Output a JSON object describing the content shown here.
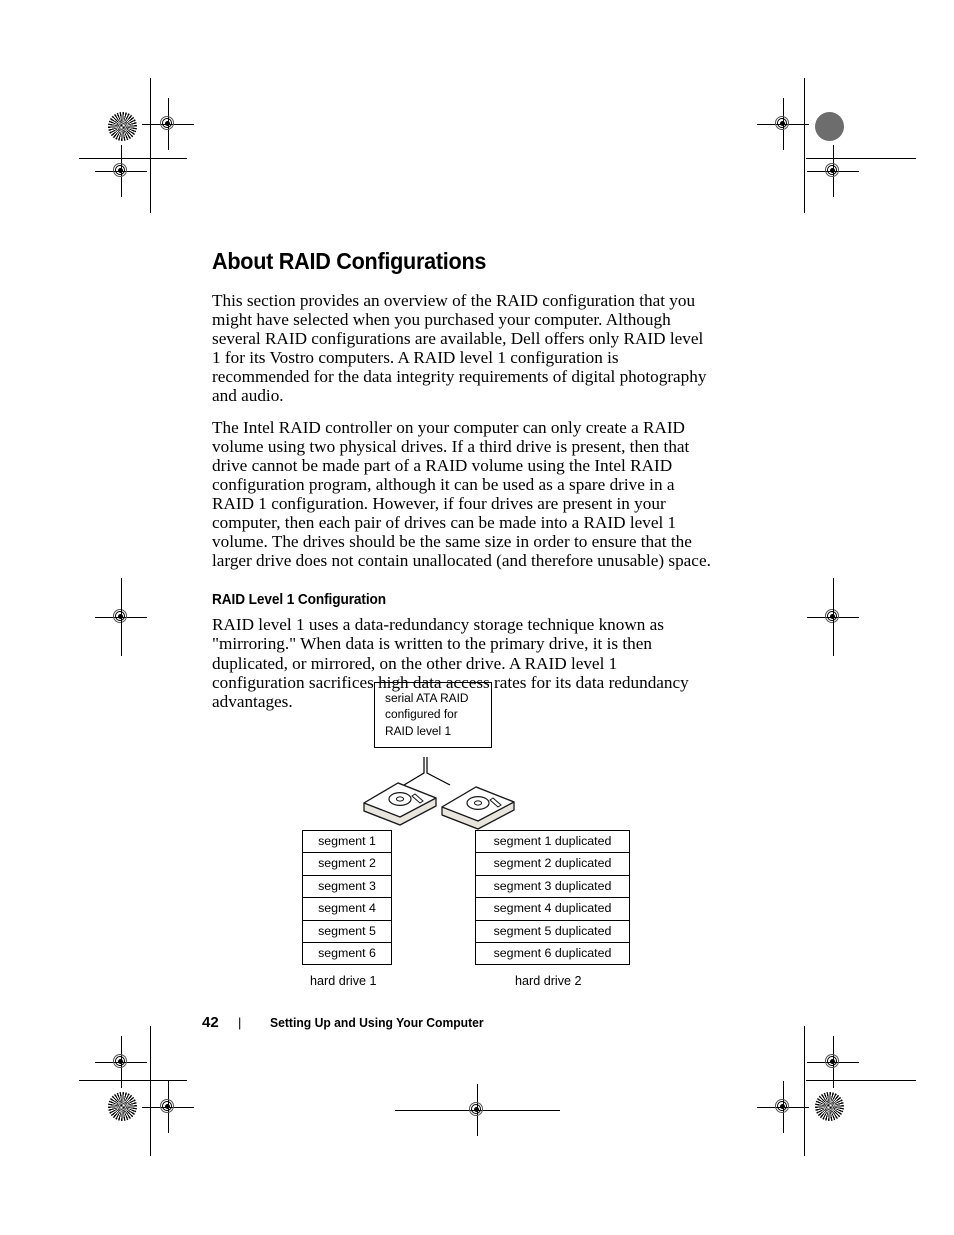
{
  "document": {
    "heading": "About RAID Configurations",
    "paragraphs": [
      "This section provides an overview of the RAID configuration that you might have selected when you purchased your computer. Although several RAID configurations are available, Dell offers only RAID level 1 for its Vostro computers. A RAID level 1 configuration is recommended for the data integrity requirements of digital photography and audio.",
      "The Intel RAID controller on your computer can only create a RAID volume using two physical drives. If a third drive is present, then that drive cannot be made part of a RAID volume using the Intel RAID configuration program, although it can be used as a spare drive in a RAID 1 configuration. However, if four drives are present in your computer, then each pair of drives can be made into a RAID level 1 volume. The drives should be the same size in order to ensure that the larger drive does not contain unallocated (and therefore unusable) space."
    ],
    "subheading": "RAID Level 1 Configuration",
    "subsection_paragraph": "RAID level 1 uses a data-redundancy storage technique known as \"mirroring.\" When data is written to the primary drive, it is then duplicated, or mirrored, on the other drive. A RAID level 1 configuration sacrifices high data access rates for its data redundancy advantages."
  },
  "figure": {
    "callout": {
      "line1": "serial ATA RAID",
      "line2": "configured for",
      "line3": "RAID level 1"
    },
    "drive1": {
      "caption": "hard drive 1",
      "segments": [
        "segment 1",
        "segment 2",
        "segment 3",
        "segment 4",
        "segment 5",
        "segment 6"
      ]
    },
    "drive2": {
      "caption": "hard drive 2",
      "segments": [
        "segment 1 duplicated",
        "segment 2 duplicated",
        "segment 3 duplicated",
        "segment 4 duplicated",
        "segment 5 duplicated",
        "segment 6 duplicated"
      ]
    }
  },
  "footer": {
    "page_number": "42",
    "separator": "|",
    "chapter": "Setting Up and Using Your Computer"
  },
  "colors": {
    "text": "#000000",
    "page_background": "#ffffff",
    "density_patch": "#6d6d6d"
  }
}
